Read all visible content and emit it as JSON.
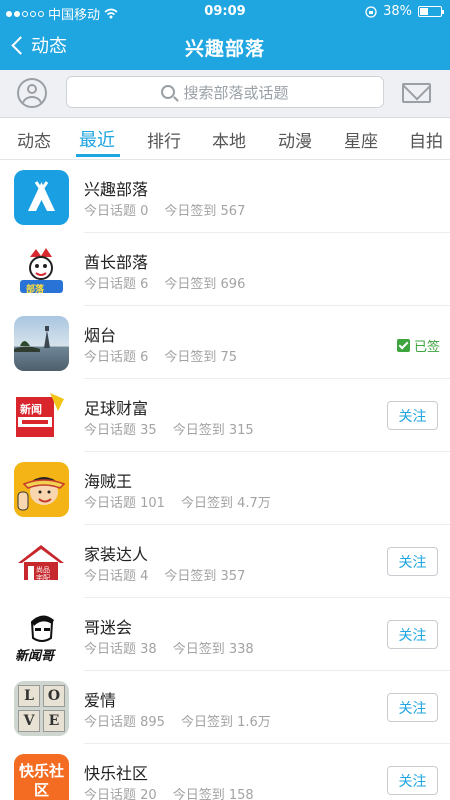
{
  "status_bar": {
    "carrier": "中国移动",
    "time": "09:09",
    "battery": "38%",
    "battery_level": 0.38,
    "signal_icon": "signal-dots-icon",
    "wifi_icon": "wifi-icon",
    "lock_icon": "rotation-lock-icon"
  },
  "nav": {
    "back_label": "动态",
    "title": "兴趣部落"
  },
  "search": {
    "placeholder": "搜索部落或话题",
    "avatar_icon": "user-avatar-icon",
    "mail_icon": "mail-icon"
  },
  "tabs": [
    "动态",
    "最近",
    "排行",
    "本地",
    "动漫",
    "星座",
    "自拍"
  ],
  "active_tab": "最近",
  "colors": {
    "accent": "#1fa5e0",
    "signed_green": "#3ea43e",
    "stat_gray": "#a3a3a3"
  },
  "list": [
    {
      "name": "兴趣部落",
      "topics": "今日话题 0",
      "checkins": "今日签到 567",
      "action": ""
    },
    {
      "name": "酋长部落",
      "topics": "今日话题 6",
      "checkins": "今日签到 696",
      "action": ""
    },
    {
      "name": "烟台",
      "topics": "今日话题 6",
      "checkins": "今日签到 75",
      "action": "已签"
    },
    {
      "name": "足球财富",
      "topics": "今日话题 35",
      "checkins": "今日签到 315",
      "action": "关注"
    },
    {
      "name": "海贼王",
      "topics": "今日话题 101",
      "checkins": "今日签到 4.7万",
      "action": ""
    },
    {
      "name": "家装达人",
      "topics": "今日话题 4",
      "checkins": "今日签到 357",
      "action": "关注"
    },
    {
      "name": "哥迷会",
      "topics": "今日话题 38",
      "checkins": "今日签到 338",
      "action": "关注"
    },
    {
      "name": "爱情",
      "topics": "今日话题 895",
      "checkins": "今日签到 1.6万",
      "action": "关注"
    },
    {
      "name": "快乐社区",
      "topics": "今日话题 20",
      "checkins": "今日签到 158",
      "action": "关注"
    }
  ],
  "logo_text": {
    "chief": "部落",
    "football": "新闻",
    "home": "尚品宅配",
    "gemi": "新闻哥",
    "love_letters": [
      "L",
      "V",
      "E",
      "O"
    ],
    "happy": "快乐社区"
  }
}
